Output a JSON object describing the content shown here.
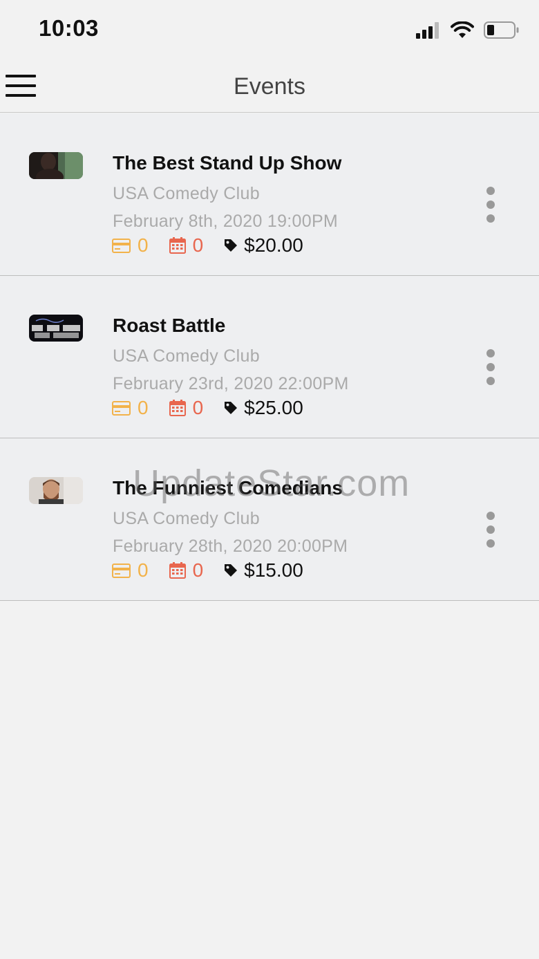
{
  "status_bar": {
    "time": "10:03"
  },
  "nav": {
    "title": "Events"
  },
  "colors": {
    "ticket_accent": "#f2b24a",
    "calendar_accent": "#e8664e",
    "secondary_text": "#aaaaaa"
  },
  "events": [
    {
      "title": "The Best Stand Up Show",
      "venue": "USA Comedy Club",
      "date": "February 8th, 2020 19:00PM",
      "tickets": "0",
      "dates": "0",
      "price": "$20.00"
    },
    {
      "title": "Roast Battle",
      "venue": "USA Comedy Club",
      "date": "February 23rd, 2020 22:00PM",
      "tickets": "0",
      "dates": "0",
      "price": "$25.00"
    },
    {
      "title": "The Funniest Comedians",
      "venue": "USA Comedy Club",
      "date": "February 28th, 2020 20:00PM",
      "tickets": "0",
      "dates": "0",
      "price": "$15.00"
    }
  ],
  "watermark": "UpdateStar.com"
}
